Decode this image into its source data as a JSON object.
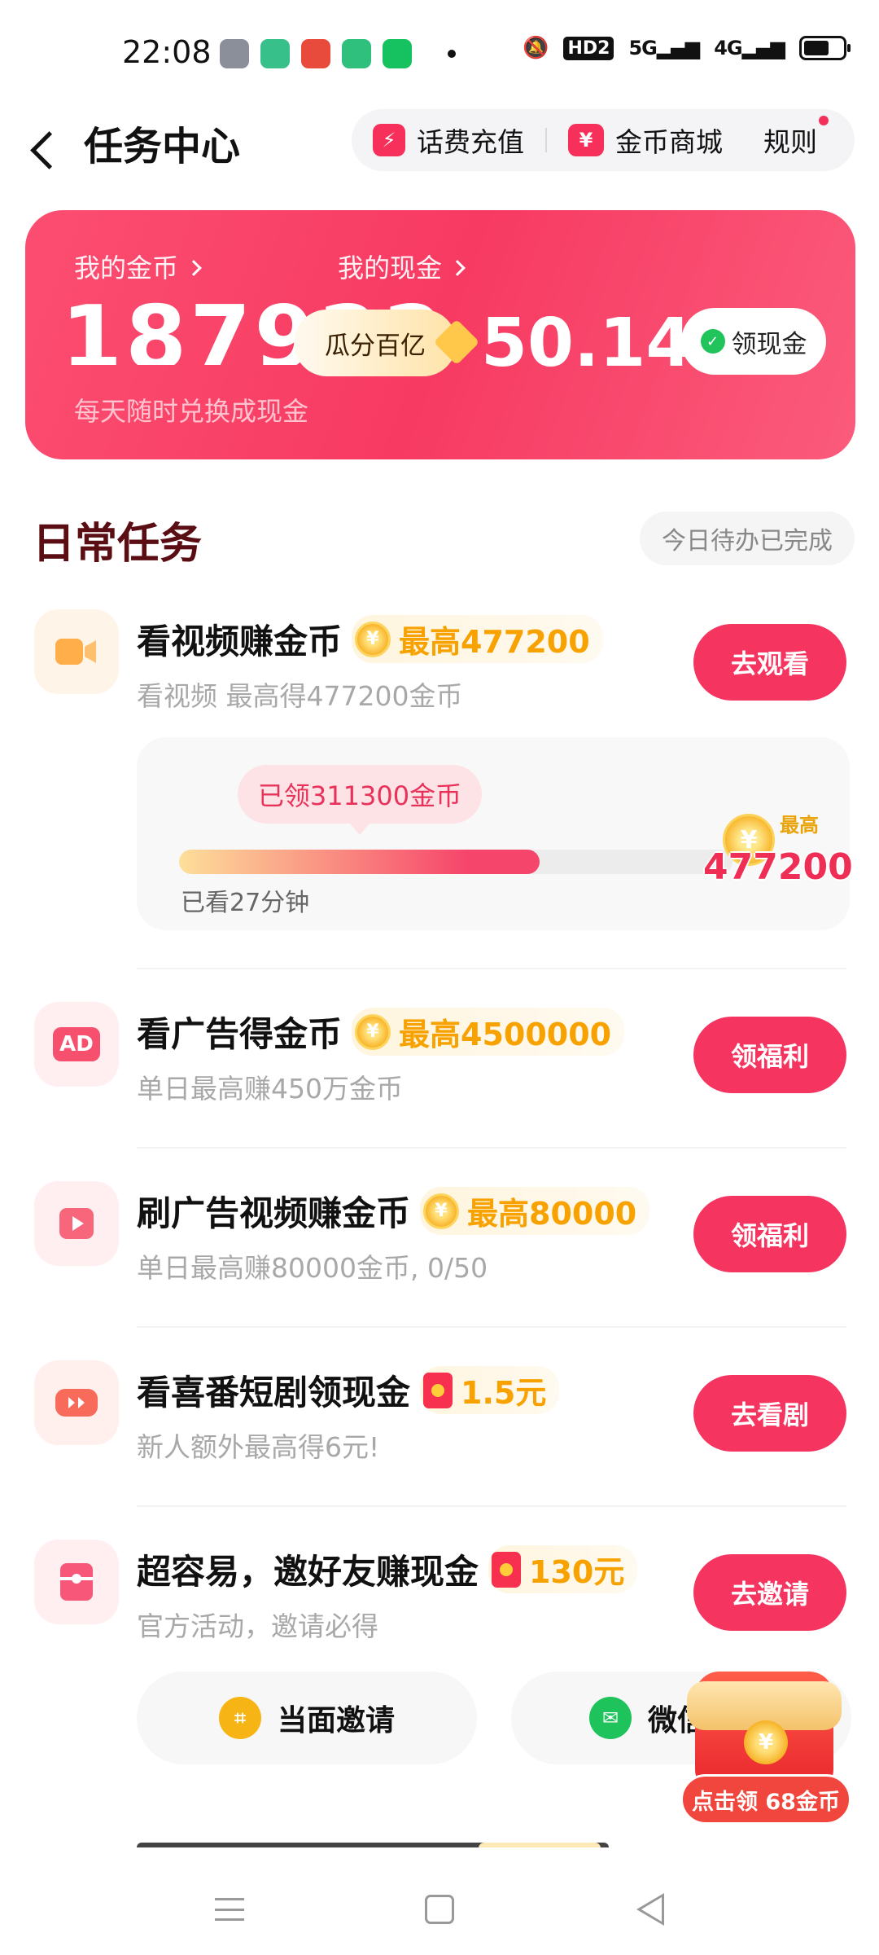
{
  "status_bar": {
    "time": "22:08",
    "notification_icons": [
      "settings-app-icon",
      "multiwindow-app-icon",
      "clown-app-icon",
      "phone-app-icon",
      "wallet-app-icon"
    ],
    "hd_label": "HD2",
    "signal_5g": "5G",
    "signal_4g": "4G"
  },
  "header": {
    "title": "任务中心",
    "recharge_label": "话费充值",
    "mall_label": "金币商城",
    "mall_icon_glyph": "¥",
    "rules_label": "规则"
  },
  "banner": {
    "coins_label": "我的金币",
    "coins_value": "187922",
    "coins_sub": "每天随时兑换成现金",
    "share_label": "瓜分百亿",
    "cash_label": "我的现金",
    "cash_value": "50.14",
    "get_cash_label": "领现金"
  },
  "section": {
    "title": "日常任务",
    "badge": "今日待办已完成"
  },
  "tasks": [
    {
      "title": "看视频赚金币",
      "reward": "最高477200",
      "desc": "看视频 最高得477200金币",
      "button": "去观看",
      "icon": "video-camera-icon"
    },
    {
      "title": "看广告得金币",
      "reward": "最高4500000",
      "desc": "单日最高赚450万金币",
      "button": "领福利",
      "icon": "ad-icon",
      "icon_text": "AD"
    },
    {
      "title": "刷广告视频赚金币",
      "reward": "最高80000",
      "desc": "单日最高赚80000金币, 0/50",
      "button": "领福利",
      "icon": "play-video-icon"
    },
    {
      "title": "看喜番短剧领现金",
      "reward": "1.5元",
      "desc": "新人额外最高得6元!",
      "button": "去看剧",
      "icon": "short-drama-icon"
    },
    {
      "title": "超容易，邀好友赚现金",
      "reward": "130元",
      "desc": "官方活动，邀请必得",
      "button": "去邀请",
      "icon": "invite-card-icon"
    }
  ],
  "progress": {
    "received": "已领311300金币",
    "watched": "已看27分钟",
    "max_tag": "最高",
    "max_value": "477200",
    "fraction": 0.652
  },
  "invite": {
    "face_label": "当面邀请",
    "wechat_label": "微信"
  },
  "float_pack": {
    "label": "点击领 68金币"
  },
  "coin_glyph": "¥",
  "colors": {
    "primary": "#f53560",
    "reward_gold": "#f7a200",
    "section_title": "#5a0d12"
  }
}
